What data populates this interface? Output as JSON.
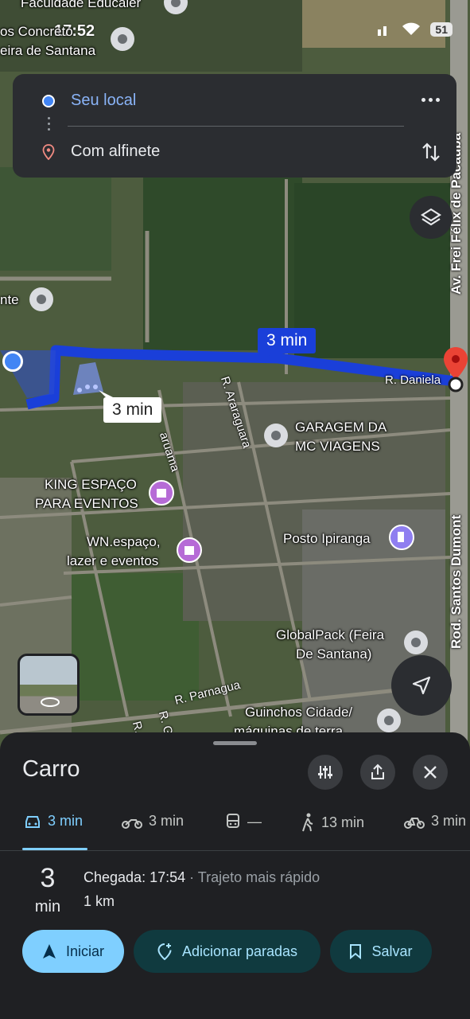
{
  "status_bar": {
    "time": "17:52",
    "battery": "51"
  },
  "route_card": {
    "origin": "Seu local",
    "destination": "Com alfinete"
  },
  "map": {
    "bubble_main": "3 min",
    "bubble_alt": "3 min",
    "labels": {
      "top_place_1": "Faculdade Educaler",
      "top_place_2": "os Concreto",
      "top_place_3": "eira de Santana",
      "left_place": "nte",
      "garagem_1": "GARAGEM DA",
      "garagem_2": "MC VIAGENS",
      "king_1": "KING ESPAÇO",
      "king_2": "PARA EVENTOS",
      "wn_1": "WN.espaço,",
      "wn_2": "lazer e eventos",
      "posto": "Posto Ipiranga",
      "globalpack_1": "GlobalPack (Feira",
      "globalpack_2": "De Santana)",
      "guinchos_1": "Guinchos Cidade/",
      "guinchos_2": "máquinas de terra"
    },
    "streets": {
      "daniela": "R. Daniela",
      "araraguara": "R. Araraguara",
      "aruama": "aruama",
      "parnagua": "R. Parnagua",
      "r_g": "R. G",
      "r_short": "R.",
      "av_frei": "Av. Frei Félix de Pacaúba",
      "rod_santos": "Rod. Santos Dumont"
    }
  },
  "sheet": {
    "title": "Carro",
    "modes": [
      {
        "label": "3 min",
        "icon": "car-icon"
      },
      {
        "label": "3 min",
        "icon": "motorcycle-icon"
      },
      {
        "label": "—",
        "icon": "transit-icon"
      },
      {
        "label": "13 min",
        "icon": "walk-icon"
      },
      {
        "label": "3 min",
        "icon": "bike-icon"
      }
    ],
    "duration_value": "3",
    "duration_unit": "min",
    "arrival_label": "Chegada: 17:54",
    "arrival_sub": " · Trajeto mais rápido",
    "distance": "1 km",
    "buttons": {
      "start": "Iniciar",
      "add_stops": "Adicionar paradas",
      "save": "Salvar"
    }
  },
  "colors": {
    "route": "#1a3fd9",
    "accent": "#7fcfff",
    "sheet_bg": "#1f2023",
    "card_bg": "#2b2d31",
    "pin_red": "#ea4335"
  }
}
